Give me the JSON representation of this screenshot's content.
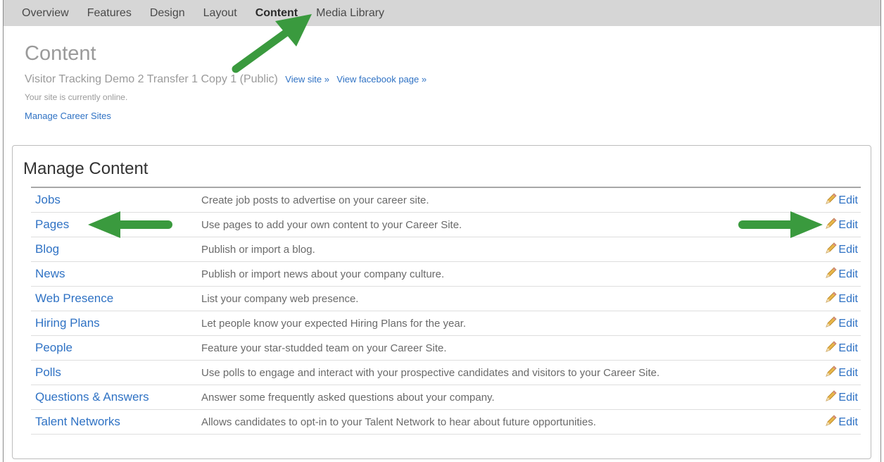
{
  "nav": {
    "tabs": [
      {
        "label": "Overview"
      },
      {
        "label": "Features"
      },
      {
        "label": "Design"
      },
      {
        "label": "Layout"
      },
      {
        "label": "Content"
      },
      {
        "label": "Media Library"
      }
    ],
    "active": "Content"
  },
  "header": {
    "title": "Content",
    "site_name": "Visitor Tracking Demo 2 Transfer 1 Copy 1 (Public)",
    "view_site": "View site »",
    "view_facebook": "View facebook page »",
    "status": "Your site is currently online.",
    "manage_link": "Manage Career Sites"
  },
  "panel": {
    "title": "Manage Content",
    "edit_label": "Edit",
    "rows": [
      {
        "name": "Jobs",
        "description": "Create job posts to advertise on your career site."
      },
      {
        "name": "Pages",
        "description": "Use pages to add your own content to your Career Site."
      },
      {
        "name": "Blog",
        "description": "Publish or import a blog."
      },
      {
        "name": "News",
        "description": "Publish or import news about your company culture."
      },
      {
        "name": "Web Presence",
        "description": "List your company web presence."
      },
      {
        "name": "Hiring Plans",
        "description": "Let people know your expected Hiring Plans for the year."
      },
      {
        "name": "People",
        "description": "Feature your star-studded team on your Career Site."
      },
      {
        "name": "Polls",
        "description": "Use polls to engage and interact with your prospective candidates and visitors to your Career Site."
      },
      {
        "name": "Questions & Answers",
        "description": "Answer some frequently asked questions about your company."
      },
      {
        "name": "Talent Networks",
        "description": "Allows candidates to opt-in to your Talent Network to hear about future opportunities."
      }
    ]
  },
  "annotations": {
    "arrow_color": "#3a9a3e",
    "icons": [
      "arrow-up-right-icon",
      "arrow-left-icon",
      "arrow-right-icon",
      "pencil-icon"
    ]
  }
}
